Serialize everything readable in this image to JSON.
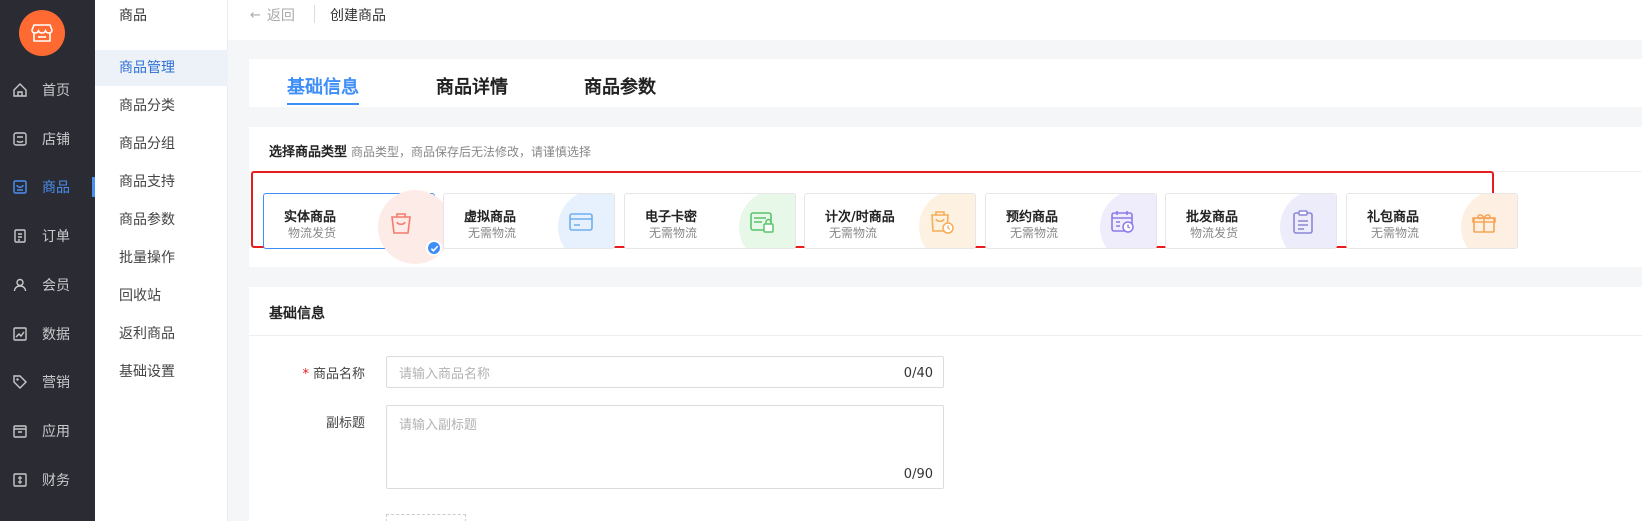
{
  "nav": {
    "items": [
      {
        "label": "首页",
        "icon": "home-icon"
      },
      {
        "label": "店铺",
        "icon": "shop-icon"
      },
      {
        "label": "商品",
        "icon": "goods-icon"
      },
      {
        "label": "订单",
        "icon": "order-icon"
      },
      {
        "label": "会员",
        "icon": "member-icon"
      },
      {
        "label": "数据",
        "icon": "chart-icon"
      },
      {
        "label": "营销",
        "icon": "tag-icon"
      },
      {
        "label": "应用",
        "icon": "app-icon"
      },
      {
        "label": "财务",
        "icon": "finance-icon"
      }
    ],
    "active_index": 2
  },
  "subnav": {
    "title": "商品",
    "items": [
      "商品管理",
      "商品分类",
      "商品分组",
      "商品支持",
      "商品参数",
      "批量操作",
      "回收站",
      "返利商品",
      "基础设置"
    ],
    "active_index": 0
  },
  "topbar": {
    "back_label": "返回",
    "breadcrumb": "创建商品"
  },
  "tabs": [
    "基础信息",
    "商品详情",
    "商品参数"
  ],
  "type_section": {
    "title": "选择商品类型",
    "hint": "商品类型，商品保存后无法修改，请谨慎选择",
    "options": [
      {
        "name": "实体商品",
        "sub": "物流发货",
        "accent": "#f57b6b",
        "bg": "#fdebe8",
        "icon": "bag-icon",
        "selected": true
      },
      {
        "name": "虚拟商品",
        "sub": "无需物流",
        "accent": "#6fb0ee",
        "bg": "#e6f1fd",
        "icon": "card-icon",
        "selected": false
      },
      {
        "name": "电子卡密",
        "sub": "无需物流",
        "accent": "#5ac46d",
        "bg": "#e7f7e8",
        "icon": "ecard-icon",
        "selected": false
      },
      {
        "name": "计次/时商品",
        "sub": "无需物流",
        "accent": "#f5ae58",
        "bg": "#fdf1e2",
        "icon": "timer-bag-icon",
        "selected": false
      },
      {
        "name": "预约商品",
        "sub": "无需物流",
        "accent": "#8c7be8",
        "bg": "#efecfc",
        "icon": "calendar-icon",
        "selected": false
      },
      {
        "name": "批发商品",
        "sub": "物流发货",
        "accent": "#8c87d8",
        "bg": "#edecfa",
        "icon": "clipboard-icon",
        "selected": false
      },
      {
        "name": "礼包商品",
        "sub": "无需物流",
        "accent": "#f5a556",
        "bg": "#fdf0e3",
        "icon": "gift-icon",
        "selected": false
      }
    ]
  },
  "basic": {
    "title": "基础信息",
    "name_label": "商品名称",
    "name_placeholder": "请输入商品名称",
    "name_count": "0/40",
    "subtitle_label": "副标题",
    "subtitle_placeholder": "请输入副标题",
    "subtitle_count": "0/90"
  }
}
